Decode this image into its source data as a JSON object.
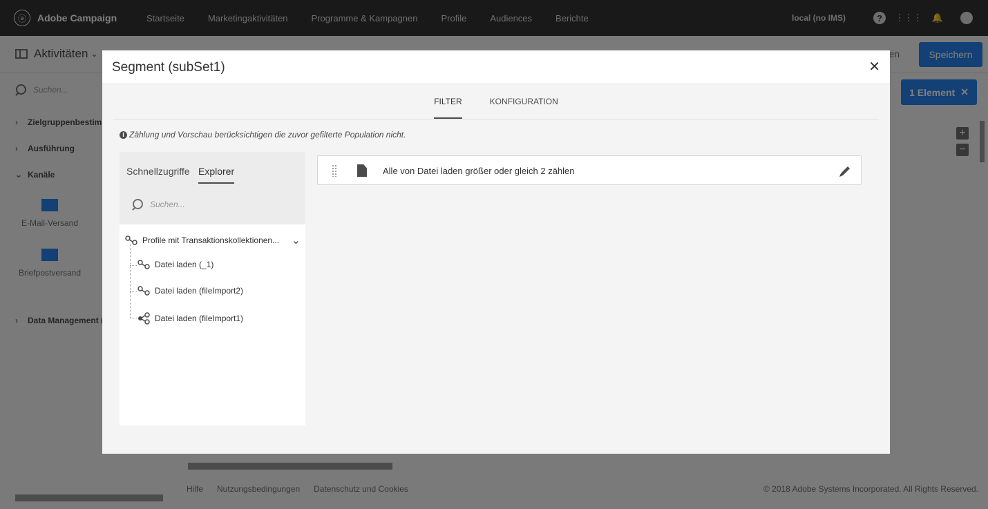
{
  "app": {
    "name": "Adobe Campaign",
    "nav": [
      "Startseite",
      "Marketingaktivitäten",
      "Programme & Kampagnen",
      "Profile",
      "Audiences",
      "Berichte"
    ],
    "environment": "local (no IMS)"
  },
  "workspace": {
    "activities_title": "Aktivitäten",
    "cancel_label": "en",
    "save_label": "Speichern",
    "search_placeholder": "Suchen...",
    "categories": [
      "Zielgruppenbestimm",
      "Ausführung",
      "Kanäle",
      "Data Management ("
    ],
    "tiles": [
      "E-Mail-Versand",
      "Briefpostversand"
    ],
    "selection_label": "1 Element",
    "footer_links": [
      "Hilfe",
      "Nutzungsbedingungen",
      "Datenschutz und Cookies"
    ],
    "copyright": "© 2018 Adobe Systems Incorporated. All Rights Reserved."
  },
  "modal": {
    "title": "Segment (subSet1)",
    "tabs": [
      "FILTER",
      "KONFIGURATION"
    ],
    "info": "Zählung und Vorschau berücksichtigen die zuvor gefilterte Population nicht.",
    "explorer_tabs": [
      "Schnellzugriffe",
      "Explorer"
    ],
    "explorer_search_placeholder": "Suchen...",
    "tree_root": "Profile mit Transaktionskollektionen...",
    "tree_children": [
      "Datei laden (_1)",
      "Datei laden (fileImport2)",
      "Datei laden (fileImport1)"
    ],
    "filter_rule": "Alle von Datei laden größer oder gleich 2 zählen"
  },
  "colors": {
    "accent": "#2680eb",
    "topnav": "#323232"
  }
}
